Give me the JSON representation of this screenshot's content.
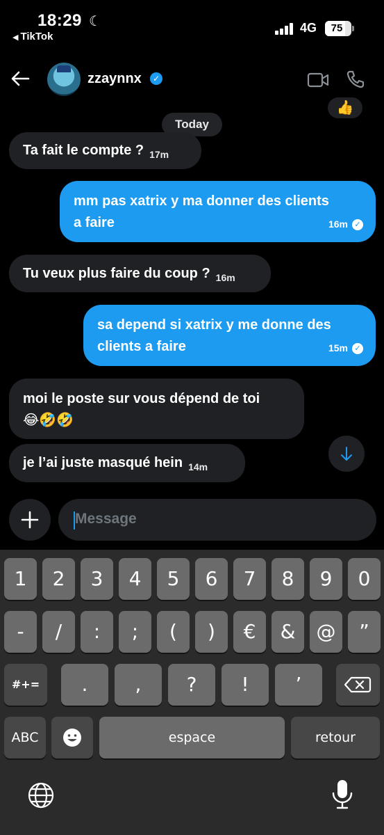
{
  "status_bar": {
    "time": "18:29",
    "back_app": "TikTok",
    "network": "4G",
    "battery": "75",
    "battery_level": 0.75
  },
  "header": {
    "username": "zzaynnx",
    "icons": [
      "back-arrow-icon",
      "verified-icon",
      "video-call-icon",
      "phone-call-icon"
    ]
  },
  "conversation": {
    "reaction": "👍",
    "date_label": "Today",
    "messages": [
      {
        "direction": "in",
        "text": "Ta fait le compte ?",
        "time": "17m"
      },
      {
        "direction": "out",
        "line1": "mm pas xatrix y ma donner des clients",
        "line2": "a faire",
        "time": "16m"
      },
      {
        "direction": "in",
        "text": "Tu veux plus faire du coup ?",
        "time": "16m"
      },
      {
        "direction": "out",
        "line1": "sa depend si xatrix y me donne des",
        "line2": "clients a faire",
        "time": "15m"
      },
      {
        "direction": "in",
        "line1": "moi le poste sur vous dépend de toi",
        "line2": "😂🤣🤣"
      },
      {
        "direction": "in",
        "text": "je l’ai juste masqué hein",
        "time": "14m"
      }
    ]
  },
  "composer": {
    "placeholder": "Message"
  },
  "keyboard": {
    "row1": [
      "1",
      "2",
      "3",
      "4",
      "5",
      "6",
      "7",
      "8",
      "9",
      "0"
    ],
    "row2": [
      "-",
      "/",
      ":",
      ";",
      "(",
      ")",
      "€",
      "&",
      "@",
      "”"
    ],
    "row3": [
      "#+=",
      ".",
      ",",
      "?",
      "!",
      "’"
    ],
    "abc": "ABC",
    "space": "espace",
    "return": "retour"
  },
  "colors": {
    "accent": "#1d9bf0",
    "incoming_bubble": "#1f2124",
    "background": "#000000",
    "keyboard_bg": "#2b2b2b",
    "key": "#6b6b6b"
  }
}
